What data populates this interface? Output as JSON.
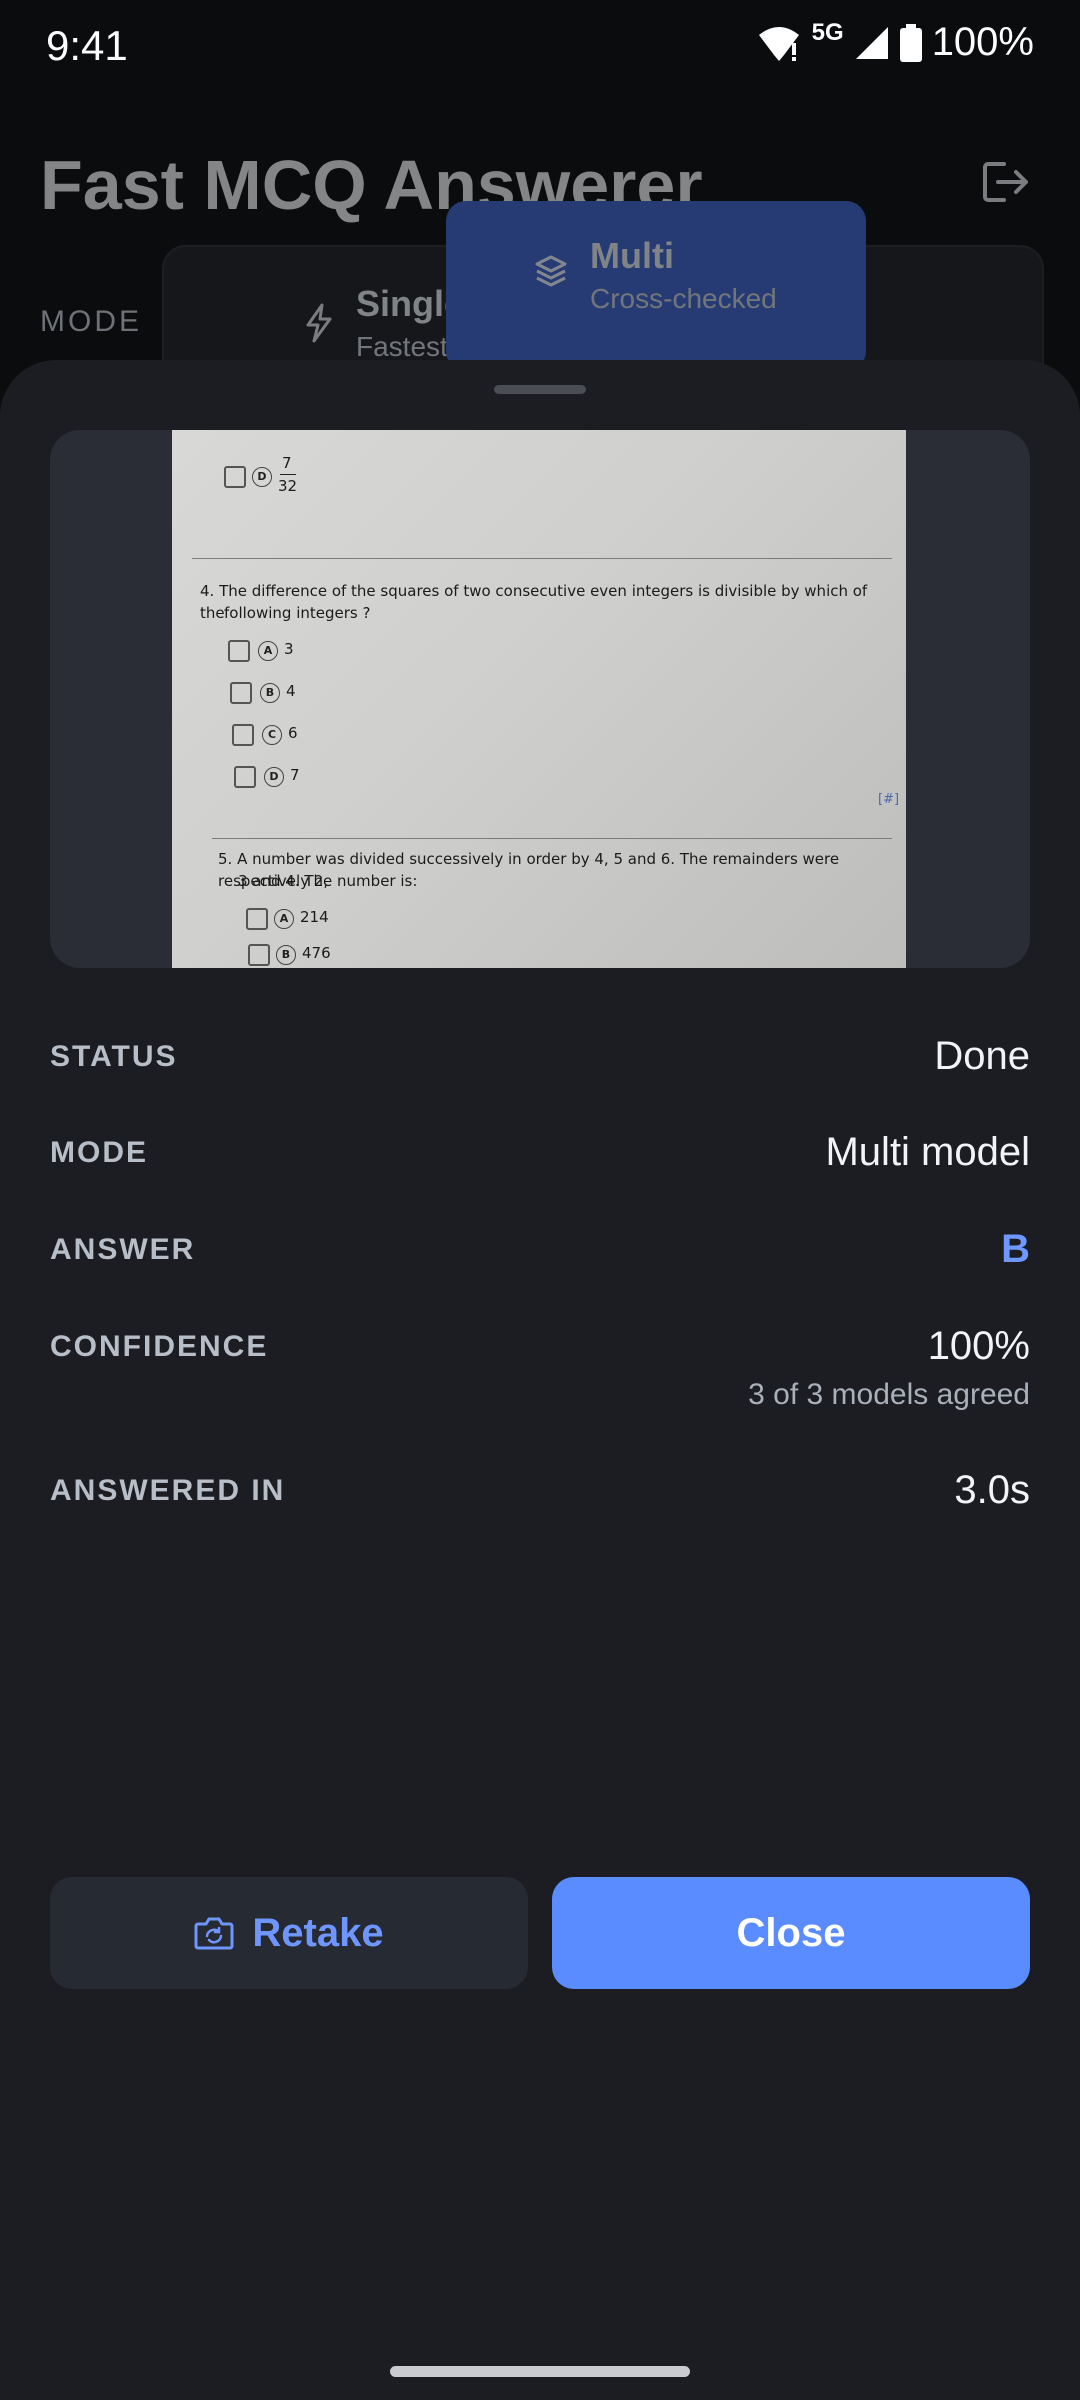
{
  "status_bar": {
    "time": "9:41",
    "network": "5G",
    "battery": "100%"
  },
  "app": {
    "title": "Fast MCQ Answerer",
    "mode_label": "MODE",
    "modes": [
      {
        "title": "Single",
        "subtitle": "Fastest"
      },
      {
        "title": "Multi",
        "subtitle": "Cross-checked"
      }
    ],
    "selected_mode": "Multi"
  },
  "preview": {
    "lines": [
      "7",
      "32",
      "4. The difference of the squares of two consecutive even integers is divisible by which of the",
      "following integers ?",
      "3",
      "4",
      "6",
      "7",
      "5. A number was divided successively in order by 4, 5 and 6. The remainders were respectively 2,",
      "3 and 4. The number is:",
      "214",
      "476",
      "[#]"
    ]
  },
  "details": {
    "status": {
      "label": "STATUS",
      "value": "Done"
    },
    "mode": {
      "label": "MODE",
      "value": "Multi model"
    },
    "answer": {
      "label": "ANSWER",
      "value": "B"
    },
    "confidence": {
      "label": "CONFIDENCE",
      "value": "100%",
      "note": "3 of 3 models agreed"
    },
    "answered_in": {
      "label": "ANSWERED IN",
      "value": "3.0s"
    }
  },
  "buttons": {
    "retake": "Retake",
    "close": "Close"
  },
  "colors": {
    "accent": "#5b8cff",
    "answer": "#6e97ff",
    "sheet": "#1b1d22"
  }
}
